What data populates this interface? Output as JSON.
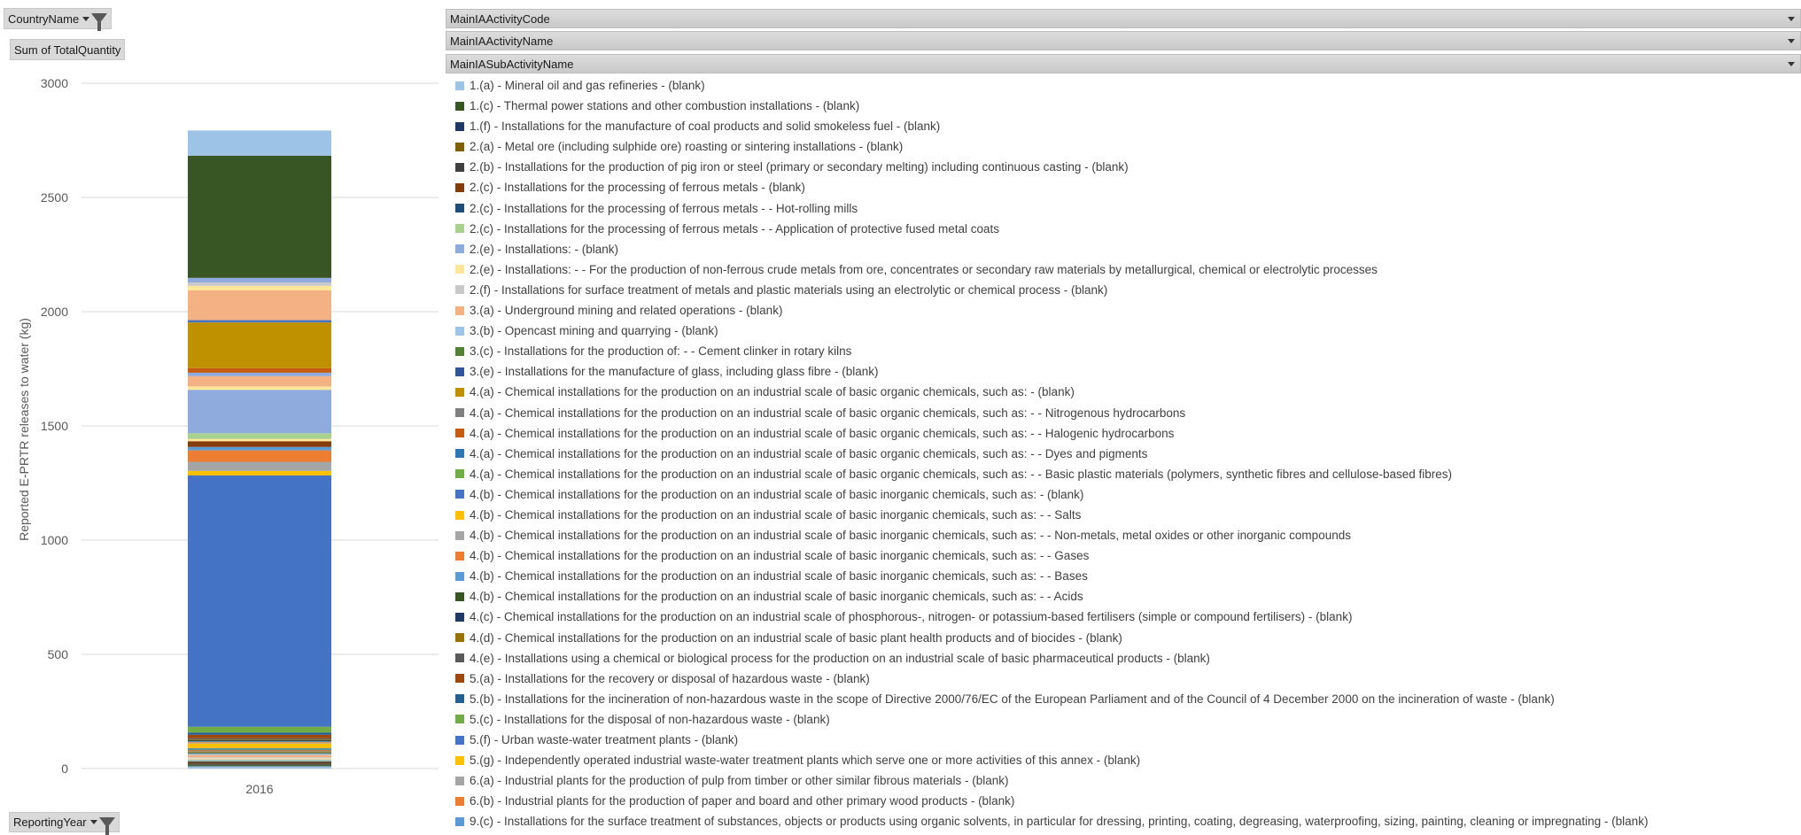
{
  "filters": {
    "country": "CountryName",
    "sum": "Sum of TotalQuantity",
    "reporting_year": "ReportingYear"
  },
  "field_bars": [
    "MainIAActivityCode",
    "MainIAActivityName",
    "MainIASubActivityName"
  ],
  "colors": {
    "gridline": "#d9d9d9",
    "axis_text": "#595959"
  },
  "chart_data": {
    "type": "bar",
    "stacked": true,
    "categories": [
      "2016"
    ],
    "ylabel": "Reported E-PRTR releases to water (kg)",
    "ylim": [
      0,
      3000
    ],
    "yticks": [
      0,
      500,
      1000,
      1500,
      2000,
      2500,
      3000
    ],
    "grid": true,
    "legend_position": "right",
    "series": [
      {
        "name": "1.(a) - Mineral oil and gas refineries - (blank)",
        "color": "#9dc3e6",
        "values": [
          10
        ]
      },
      {
        "name": "1.(c) - Thermal power stations and other combustion installations - (blank)",
        "color": "#375623",
        "values": [
          5
        ]
      },
      {
        "name": "1.(f) - Installations for the manufacture of coal products and solid smokeless fuel - (blank)",
        "color": "#1f3864",
        "values": [
          3
        ]
      },
      {
        "name": "2.(a) - Metal ore (including sulphide ore) roasting or sintering installations - (blank)",
        "color": "#7f6000",
        "values": [
          3
        ]
      },
      {
        "name": "2.(b) - Installations for the production of pig iron or steel (primary or secondary melting) including continuous casting - (blank)",
        "color": "#404040",
        "values": [
          4
        ]
      },
      {
        "name": "2.(c) - Installations for the processing of ferrous metals - (blank)",
        "color": "#843c0c",
        "values": [
          4
        ]
      },
      {
        "name": "2.(c) - Installations for the processing of ferrous metals - - Hot-rolling mills",
        "color": "#1f4e79",
        "values": [
          3
        ]
      },
      {
        "name": "2.(c) - Installations for the processing of ferrous metals - - Application of protective fused metal coats",
        "color": "#a9d18e",
        "values": [
          4
        ]
      },
      {
        "name": "2.(e) - Installations: - (blank)",
        "color": "#8faadc",
        "values": [
          4
        ]
      },
      {
        "name": "2.(e) - Installations: - - For the production of non-ferrous crude metals from ore, concentrates or secondary raw materials by metallurgical, chemical or electrolytic processes",
        "color": "#ffe699",
        "values": [
          5
        ]
      },
      {
        "name": "2.(f) - Installations for surface treatment of metals and plastic materials using an electrolytic or chemical process - (blank)",
        "color": "#c9c9c9",
        "values": [
          5
        ]
      },
      {
        "name": "3.(a) - Underground mining and related operations - (blank)",
        "color": "#f4b183",
        "values": [
          10
        ]
      },
      {
        "name": "3.(b) - Opencast mining and quarrying - (blank)",
        "color": "#9dc3e6",
        "values": [
          5
        ]
      },
      {
        "name": "3.(c) - Installations for the production of: - - Cement clinker in rotary kilns",
        "color": "#548235",
        "values": [
          3
        ]
      },
      {
        "name": "3.(e) - Installations for the manufacture of glass, including glass fibre - (blank)",
        "color": "#2f5597",
        "values": [
          3
        ]
      },
      {
        "name": "4.(a) - Chemical installations for the production on an industrial scale of basic organic chemicals, such as: - (blank)",
        "color": "#bf9000",
        "values": [
          4
        ]
      },
      {
        "name": "4.(a) - Chemical installations for the production on an industrial scale of basic organic chemicals, such as: - - Nitrogenous hydrocarbons",
        "color": "#7f7f7f",
        "values": [
          3
        ]
      },
      {
        "name": "4.(a) - Chemical installations for the production on an industrial scale of basic organic chemicals, such as: - - Halogenic hydrocarbons",
        "color": "#c55a11",
        "values": [
          3
        ]
      },
      {
        "name": "4.(a) - Chemical installations for the production on an industrial scale of basic organic chemicals, such as: - - Dyes and pigments",
        "color": "#2e75b6",
        "values": [
          3
        ]
      },
      {
        "name": "4.(a) - Chemical installations for the production on an industrial scale of basic organic chemicals, such as: - - Basic plastic materials (polymers, synthetic fibres and cellulose-based fibres)",
        "color": "#70ad47",
        "values": [
          3
        ]
      },
      {
        "name": "4.(b) - Chemical installations for the production on an industrial scale of basic inorganic chemicals, such as: - (blank)",
        "color": "#4472c4",
        "values": [
          3
        ]
      },
      {
        "name": "4.(b) - Chemical installations for the production on an industrial scale of basic inorganic chemicals, such as: - - Salts",
        "color": "#ffc000",
        "values": [
          20
        ]
      },
      {
        "name": "4.(b) - Chemical installations for the production on an industrial scale of basic inorganic chemicals, such as: - - Non-metals, metal oxides or other inorganic compounds",
        "color": "#a5a5a5",
        "values": [
          3
        ]
      },
      {
        "name": "4.(b) - Chemical installations for the production on an industrial scale of basic inorganic chemicals, such as: - - Gases",
        "color": "#ed7d31",
        "values": [
          3
        ]
      },
      {
        "name": "4.(b) - Chemical installations for the production on an industrial scale of basic inorganic chemicals, such as: - - Bases",
        "color": "#5b9bd5",
        "values": [
          3
        ]
      },
      {
        "name": "4.(b) - Chemical installations for the production on an industrial scale of basic inorganic chemicals, such as: - - Acids",
        "color": "#375623",
        "values": [
          3
        ]
      },
      {
        "name": "4.(c) - Chemical installations for the production on an industrial scale of phosphorous-, nitrogen- or potassium-based fertilisers (simple or compound fertilisers) - (blank)",
        "color": "#203864",
        "values": [
          3
        ]
      },
      {
        "name": "4.(d) - Chemical installations for the production on an industrial scale of basic plant health products and of biocides - (blank)",
        "color": "#997300",
        "values": [
          3
        ]
      },
      {
        "name": "4.(e) - Installations using a chemical or biological process for the production on an industrial scale of basic pharmaceutical products - (blank)",
        "color": "#595959",
        "values": [
          5
        ]
      },
      {
        "name": "5.(a) - Installations for the recovery or disposal of hazardous waste - (blank)",
        "color": "#9e480e",
        "values": [
          15
        ]
      },
      {
        "name": "5.(b) - Installations for the incineration of non-hazardous waste in the scope of Directive 2000/76/EC of the European Parliament and of the Council of 4 December 2000 on the incineration of waste - (blank)",
        "color": "#255e91",
        "values": [
          10
        ]
      },
      {
        "name": "5.(c) - Installations for the disposal of non-hazardous waste - (blank)",
        "color": "#70ad47",
        "values": [
          25
        ]
      },
      {
        "name": "5.(f) - Urban waste-water treatment plants - (blank)",
        "color": "#4472c4",
        "values": [
          1100
        ]
      },
      {
        "name": "5.(g) - Independently operated industrial waste-water treatment plants which serve one or more activities of this annex - (blank)",
        "color": "#ffc000",
        "values": [
          20
        ]
      },
      {
        "name": "6.(a) - Industrial plants for the production of pulp from timber or other similar fibrous materials - (blank)",
        "color": "#a5a5a5",
        "values": [
          40
        ]
      },
      {
        "name": "6.(b) - Industrial plants for the production of paper and board and other primary wood products - (blank)",
        "color": "#ed7d31",
        "values": [
          50
        ]
      },
      {
        "name": "9.(c) - Installations for the surface treatment of substances, objects or products using organic solvents, in particular for dressing, printing, coating, degreasing, waterproofing, sizing, painting, cleaning or impregnating - (blank)",
        "color": "#5b9bd5",
        "values": [
          15
        ]
      },
      {
        "name": "",
        "color": "#843c0c",
        "values": [
          25
        ]
      },
      {
        "name": "",
        "color": "#ffe699",
        "values": [
          10
        ]
      },
      {
        "name": "",
        "color": "#a9d18e",
        "values": [
          25
        ]
      },
      {
        "name": "",
        "color": "#8faadc",
        "values": [
          190
        ]
      },
      {
        "name": "",
        "color": "#ffe699",
        "values": [
          15
        ]
      },
      {
        "name": "",
        "color": "#f4b183",
        "values": [
          45
        ]
      },
      {
        "name": "",
        "color": "#8faadc",
        "values": [
          15
        ]
      },
      {
        "name": "",
        "color": "#c55a11",
        "values": [
          20
        ]
      },
      {
        "name": "",
        "color": "#bf9000",
        "values": [
          200
        ]
      },
      {
        "name": "",
        "color": "#4472c4",
        "values": [
          10
        ]
      },
      {
        "name": "",
        "color": "#f4b183",
        "values": [
          130
        ]
      },
      {
        "name": "",
        "color": "#ffe699",
        "values": [
          20
        ]
      },
      {
        "name": "",
        "color": "#c9c9c9",
        "values": [
          15
        ]
      },
      {
        "name": "",
        "color": "#8faadc",
        "values": [
          20
        ]
      },
      {
        "name": "",
        "color": "#375623",
        "values": [
          535
        ]
      },
      {
        "name": "",
        "color": "#9dc3e6",
        "values": [
          110
        ]
      }
    ]
  }
}
